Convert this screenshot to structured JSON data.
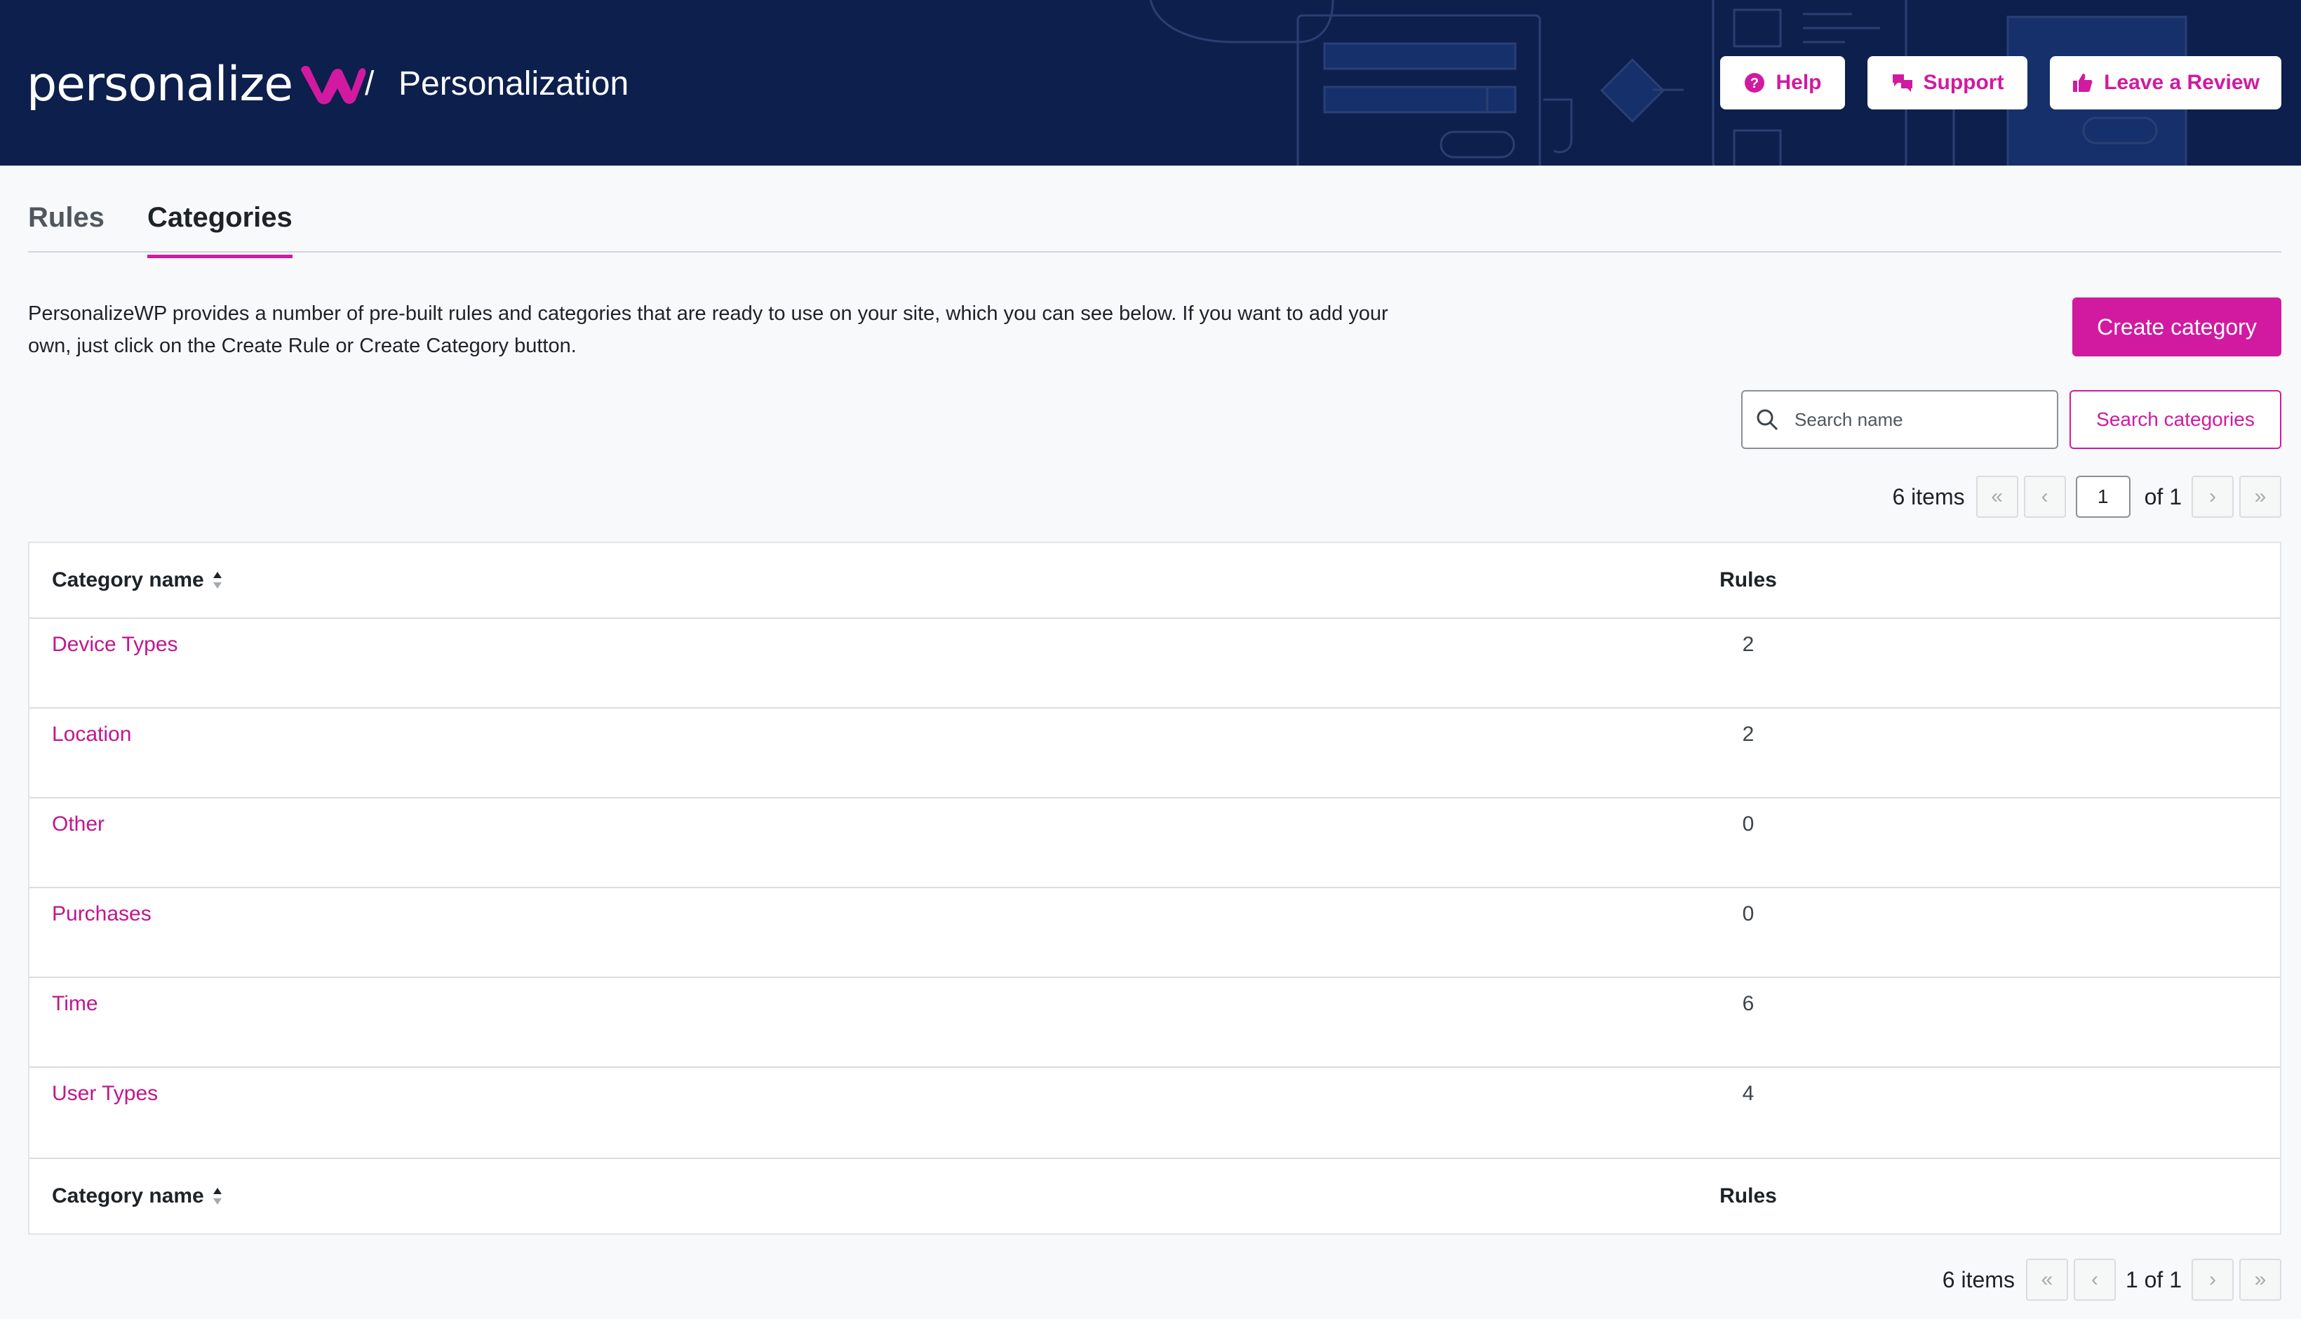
{
  "header": {
    "brand_word": "personalize",
    "breadcrumb_separator": "/",
    "page_title": "Personalization",
    "buttons": {
      "help": "Help",
      "support": "Support",
      "review": "Leave a Review"
    },
    "icons": {
      "help": "question-circle-icon",
      "support": "speech-bubbles-icon",
      "review": "thumbs-up-icon"
    },
    "colors": {
      "background": "#0d1f4c",
      "accent": "#d11aa0"
    }
  },
  "tabs": [
    {
      "label": "Rules",
      "active": false
    },
    {
      "label": "Categories",
      "active": true
    }
  ],
  "intro": {
    "description": "PersonalizeWP provides a number of pre-built rules and categories that are ready to use on your site, which you can see below. If you want to add your own, just click on the Create Rule or Create Category button.",
    "create_button": "Create category"
  },
  "search": {
    "placeholder": "Search name",
    "value": "",
    "button": "Search categories"
  },
  "pagination_top": {
    "items": "6 items",
    "first": "«",
    "prev": "‹",
    "current_page": "1",
    "of_total": "of 1",
    "next": "›",
    "last": "»"
  },
  "pagination_bottom": {
    "items": "6 items",
    "first": "«",
    "prev": "‹",
    "page_label": "1 of 1",
    "next": "›",
    "last": "»"
  },
  "table": {
    "columns": {
      "name": "Category name",
      "rules": "Rules"
    },
    "rows": [
      {
        "name": "Device Types",
        "rules": "2"
      },
      {
        "name": "Location",
        "rules": "2"
      },
      {
        "name": "Other",
        "rules": "0"
      },
      {
        "name": "Purchases",
        "rules": "0"
      },
      {
        "name": "Time",
        "rules": "6"
      },
      {
        "name": "User Types",
        "rules": "4"
      }
    ]
  }
}
